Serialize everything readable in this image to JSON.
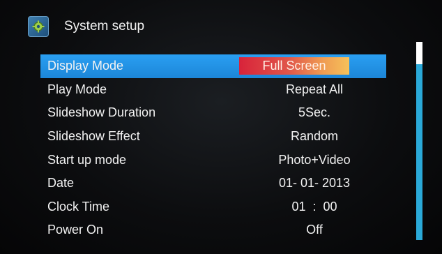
{
  "header": {
    "title": "System setup",
    "icon": "settings-gear-icon"
  },
  "menu": {
    "items": [
      {
        "label": "Display Mode",
        "value": "Full Screen",
        "selected": true
      },
      {
        "label": "Play Mode",
        "value": "Repeat All"
      },
      {
        "label": "Slideshow Duration",
        "value": "5Sec."
      },
      {
        "label": "Slideshow Effect",
        "value": "Random"
      },
      {
        "label": "Start up mode",
        "value": "Photo+Video"
      },
      {
        "label": "Date",
        "value": "01- 01- 2013"
      },
      {
        "label": "Clock Time",
        "value": "01  :  00"
      },
      {
        "label": "Power On",
        "value": "Off"
      }
    ]
  },
  "colors": {
    "selection_bar": "#2a9ff2",
    "selected_value_gradient_start": "#d8233a",
    "selected_value_gradient_end": "#f6c15a",
    "scrollbar": "#2aa9d8",
    "scroll_thumb": "#ffffff",
    "background": "#0c0d0f"
  }
}
